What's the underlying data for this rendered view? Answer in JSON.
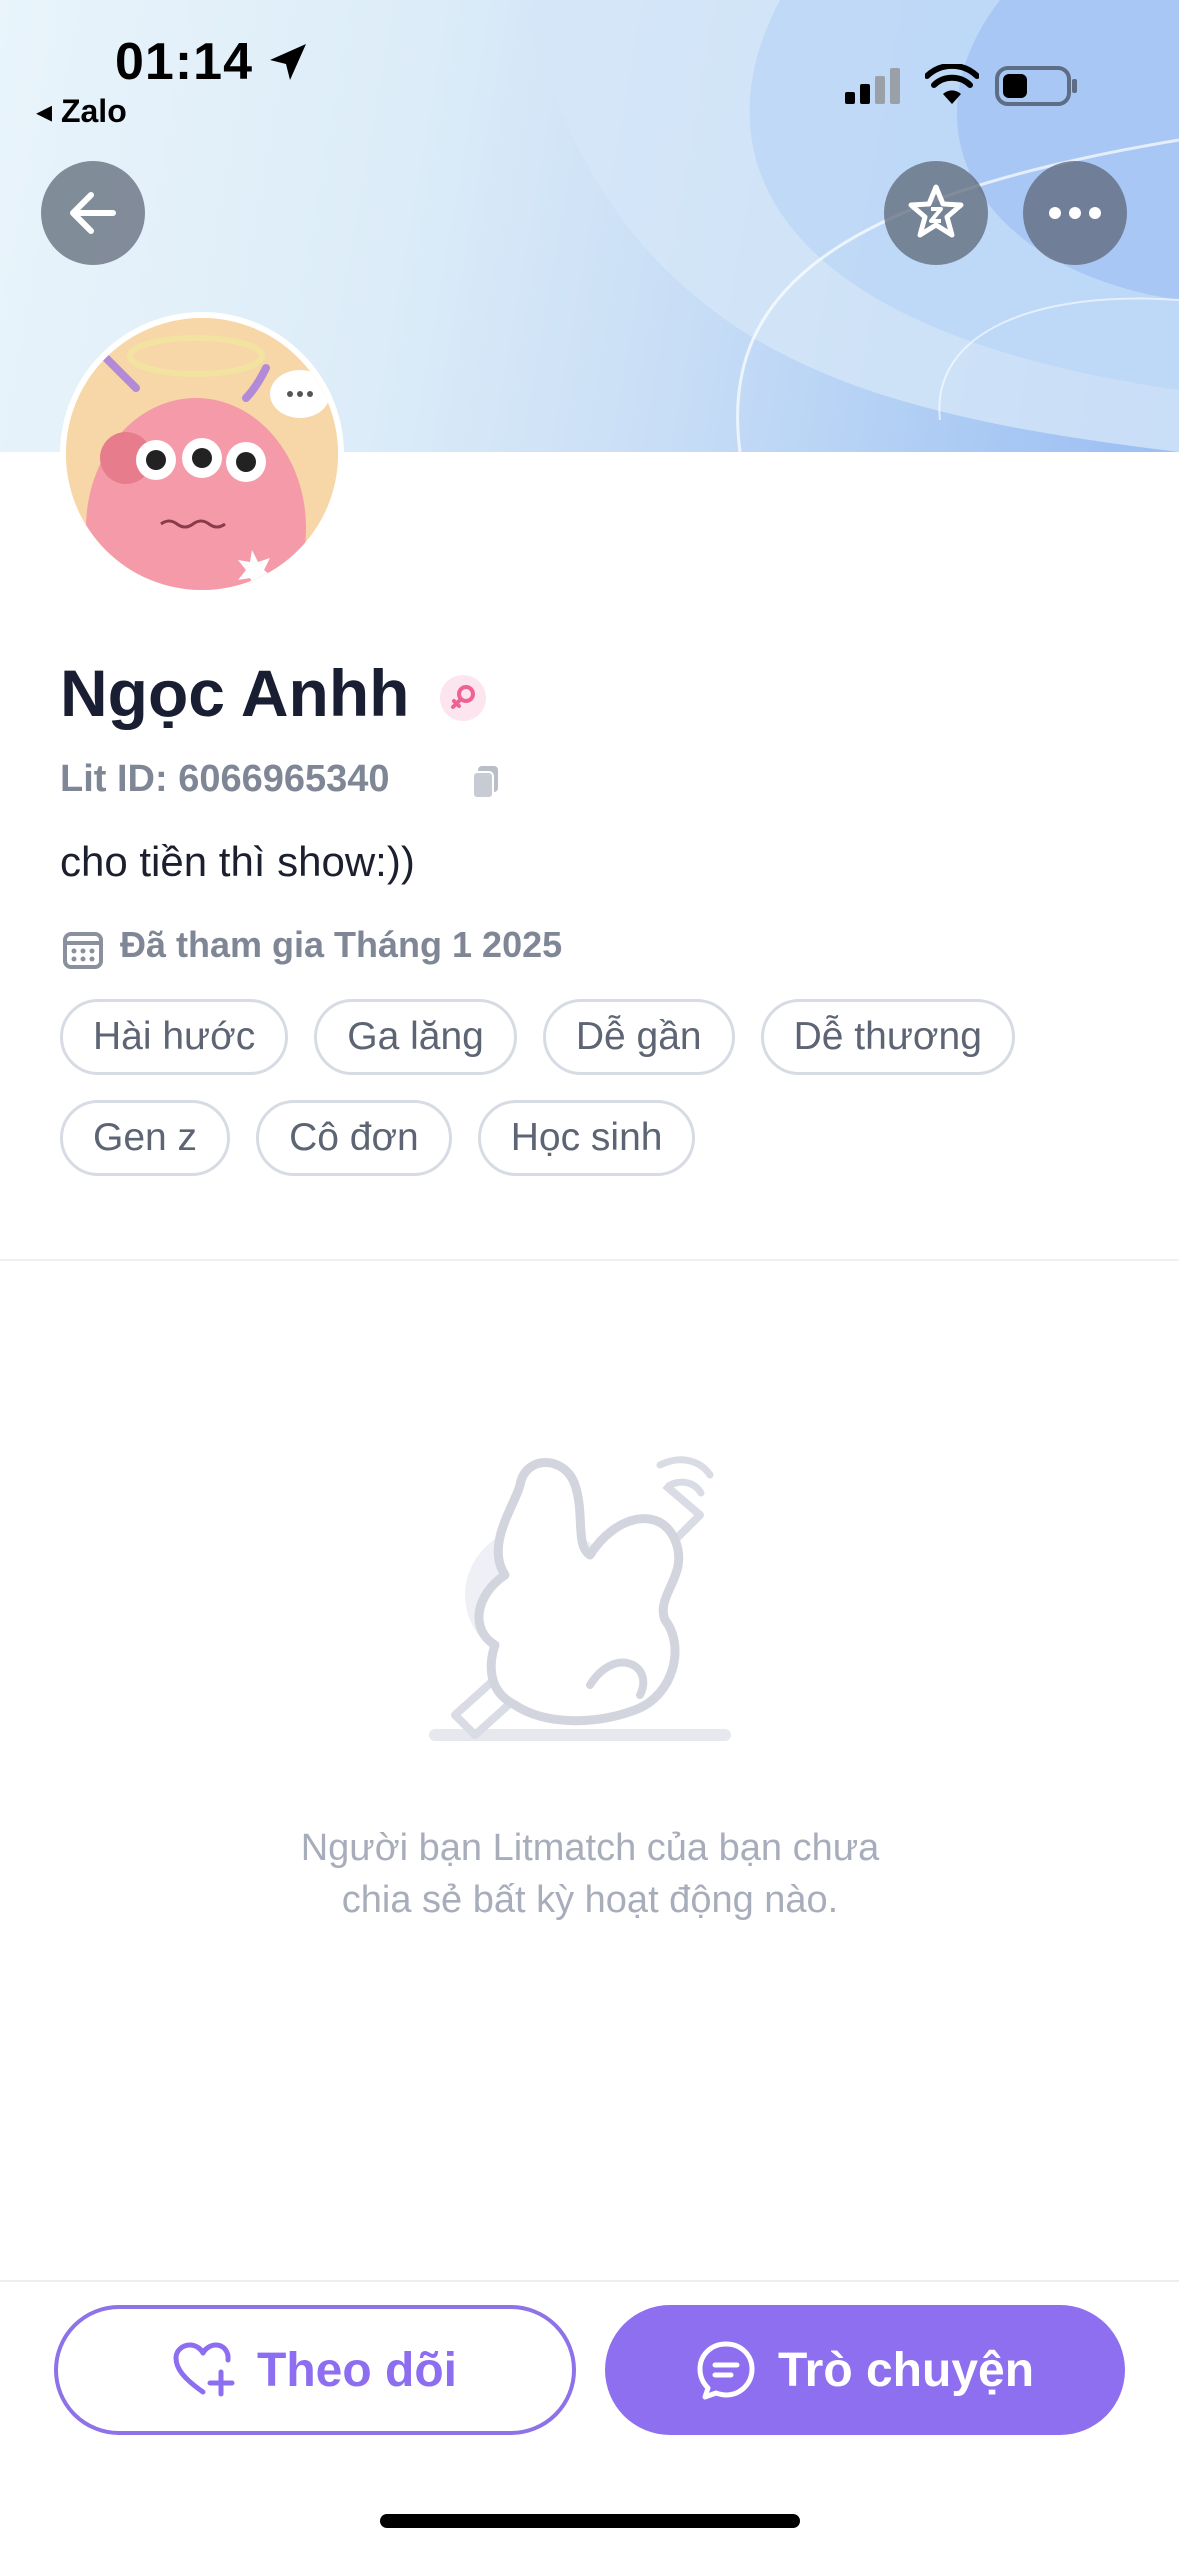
{
  "status_bar": {
    "time": "01:14",
    "back_app": "◂ Zalo"
  },
  "profile": {
    "name": "Ngọc Anhh",
    "lit_id": "Lit ID: 6066965340",
    "bio": "cho tiền thì show:))",
    "joined": "Đã tham gia Tháng 1 2025",
    "tags": [
      "Hài hước",
      "Ga lăng",
      "Dễ gần",
      "Dễ thương",
      "Gen z",
      "Cô đơn",
      "Học sinh"
    ]
  },
  "empty_state": {
    "message_line1": "Người bạn Litmatch của bạn chưa",
    "message_line2": "chia sẻ bất kỳ hoạt động nào."
  },
  "actions": {
    "follow_label": "Theo dõi",
    "chat_label": "Trò chuyện"
  },
  "icons": {
    "back": "arrow-left-icon",
    "star": "star-badge-icon",
    "more": "more-dots-icon",
    "gender": "female-icon",
    "copy": "copy-icon",
    "calendar": "calendar-icon",
    "follow": "heart-plus-icon",
    "chat": "chat-bubble-icon"
  },
  "colors": {
    "accent": "#8e6ff0",
    "muted": "#7f8696",
    "tag_border": "#d7dbe3"
  }
}
